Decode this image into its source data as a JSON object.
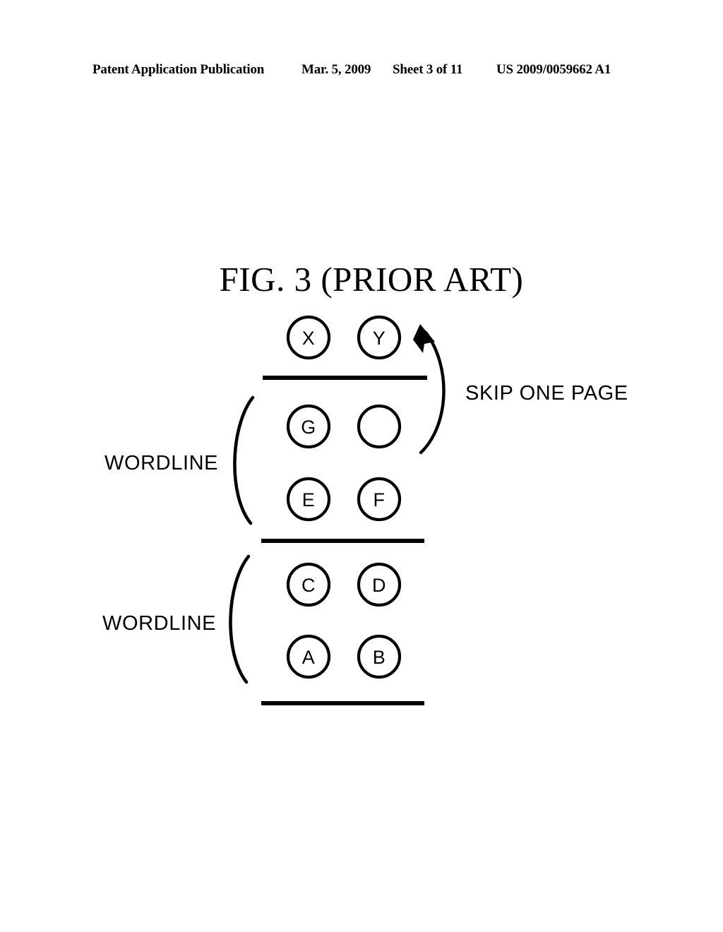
{
  "header": {
    "publication": "Patent Application Publication",
    "date": "Mar. 5, 2009",
    "sheet": "Sheet 3 of 11",
    "patent_number": "US 2009/0059662 A1"
  },
  "figure": {
    "title": "FIG. 3 (PRIOR ART)",
    "ink_color": "#000000",
    "background_color": "#ffffff"
  },
  "diagram": {
    "cells": [
      {
        "label": "X",
        "row": 0,
        "column": 0
      },
      {
        "label": "Y",
        "row": 0,
        "column": 1
      },
      {
        "label": "G",
        "row": 1,
        "column": 0
      },
      {
        "label": "",
        "row": 1,
        "column": 1
      },
      {
        "label": "E",
        "row": 2,
        "column": 0
      },
      {
        "label": "F",
        "row": 2,
        "column": 1
      },
      {
        "label": "C",
        "row": 3,
        "column": 0
      },
      {
        "label": "D",
        "row": 3,
        "column": 1
      },
      {
        "label": "A",
        "row": 4,
        "column": 0
      },
      {
        "label": "B",
        "row": 4,
        "column": 1
      }
    ],
    "wordline_upper_label": "WORDLINE",
    "wordline_lower_label": "WORDLINE",
    "skip_label": "SKIP ONE PAGE"
  }
}
